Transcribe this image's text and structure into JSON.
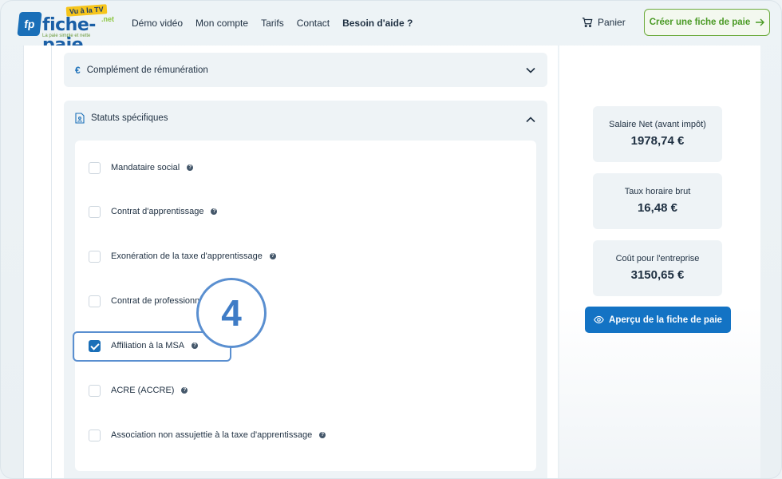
{
  "logo": {
    "brand": "fiche-paie",
    "badge": "fp",
    "tv": "Vu à la TV",
    "net": ".net",
    "tagline": "La paie simple et nette"
  },
  "nav": [
    "Démo vidéo",
    "Mon compte",
    "Tarifs",
    "Contact",
    "Besoin d'aide ?"
  ],
  "cart_label": "Panier",
  "cta_label": "Créer une fiche de paie",
  "sections": {
    "complement": "Complément de rémunération",
    "statuts": "Statuts spécifiques"
  },
  "options": [
    {
      "label": "Mandataire social",
      "checked": false
    },
    {
      "label": "Contrat d'apprentissage",
      "checked": false
    },
    {
      "label": "Exonération de la taxe d'apprentissage",
      "checked": false
    },
    {
      "label": "Contrat de professionnalisation",
      "checked": false
    },
    {
      "label": "Affiliation à la MSA",
      "checked": true
    },
    {
      "label": "ACRE (ACCRE)",
      "checked": false
    },
    {
      "label": "Association non assujettie à la taxe d'apprentissage",
      "checked": false
    }
  ],
  "step_number": "4",
  "stats": [
    {
      "label": "Salaire Net (avant impôt)",
      "value": "1978,74 €"
    },
    {
      "label": "Taux horaire brut",
      "value": "16,48 €"
    },
    {
      "label": "Coût pour l'entreprise",
      "value": "3150,65 €"
    }
  ],
  "preview_label": "Aperçu de la fiche de paie",
  "colors": {
    "primary": "#1373c4",
    "accent_green": "#4a9a25",
    "highlight": "#5a8fd0"
  }
}
